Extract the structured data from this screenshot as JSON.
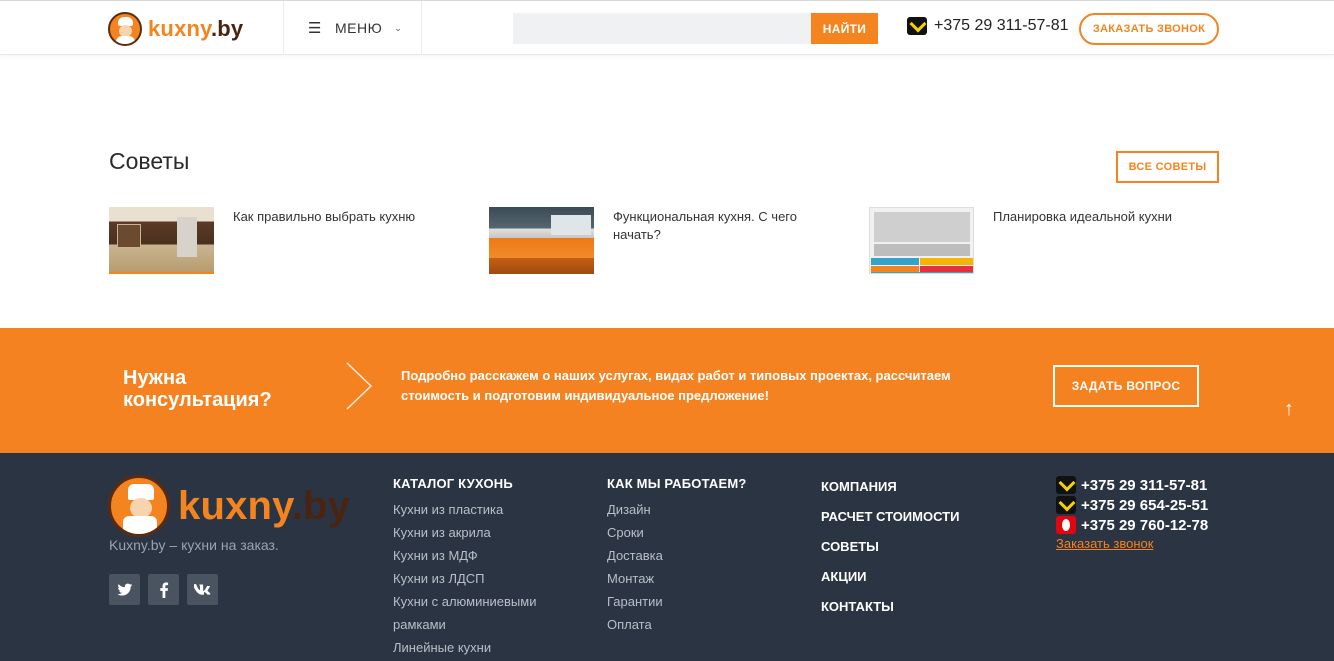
{
  "header": {
    "logo_a": "kuxny",
    "logo_b": ".by",
    "menu_label": "МЕНЮ",
    "search_placeholder": "",
    "search_button": "НАЙТИ",
    "phone": "+375 29 311-57-81",
    "callback_button": "ЗАКАЗАТЬ ЗВОНОК"
  },
  "tips": {
    "title": "Советы",
    "all_button": "ВСЕ СОВЕТЫ",
    "items": [
      {
        "title": "Как правильно выбрать кухню"
      },
      {
        "title": "Функциональная кухня. С чего начать?"
      },
      {
        "title": "Планировка идеальной кухни"
      }
    ]
  },
  "consult": {
    "title_line1": "Нужна",
    "title_line2": "консультация?",
    "text": "Подробно расскажем о наших услугах, видах работ и типовых проектах, рассчитаем стоимость и подготовим индивидуальное предложение!",
    "button": "ЗАДАТЬ ВОПРОС",
    "up_icon": "↑"
  },
  "footer": {
    "logo_a": "kuxny",
    "logo_b": ".by",
    "tagline": "Kuxny.by – кухни на заказ.",
    "socials": [
      {
        "name": "twitter-icon",
        "glyph": "t"
      },
      {
        "name": "facebook-icon",
        "glyph": "f"
      },
      {
        "name": "vk-icon",
        "glyph": "vk"
      }
    ],
    "catalog": {
      "title": "КАТАЛОГ КУХОНЬ",
      "items": [
        "Кухни из пластика",
        "Кухни из акрила",
        "Кухни из МДФ",
        "Кухни из ЛДСП",
        "Кухни с алюминиевыми рамками",
        "Линейные кухни"
      ]
    },
    "how": {
      "title": "КАК МЫ РАБОТАЕМ?",
      "items": [
        "Дизайн",
        "Сроки",
        "Доставка",
        "Монтаж",
        "Гарантии",
        "Оплата"
      ]
    },
    "links": [
      "КОМПАНИЯ",
      "РАСЧЕТ СТОИМОСТИ",
      "СОВЕТЫ",
      "АКЦИИ",
      "КОНТАКТЫ"
    ],
    "phones": [
      {
        "operator": "velcom",
        "number": "+375 29 311-57-81"
      },
      {
        "operator": "velcom",
        "number": "+375 29 654-25-51"
      },
      {
        "operator": "mts",
        "number": "+375 29 760-12-78"
      }
    ],
    "callback_link": "Заказать звонок"
  }
}
